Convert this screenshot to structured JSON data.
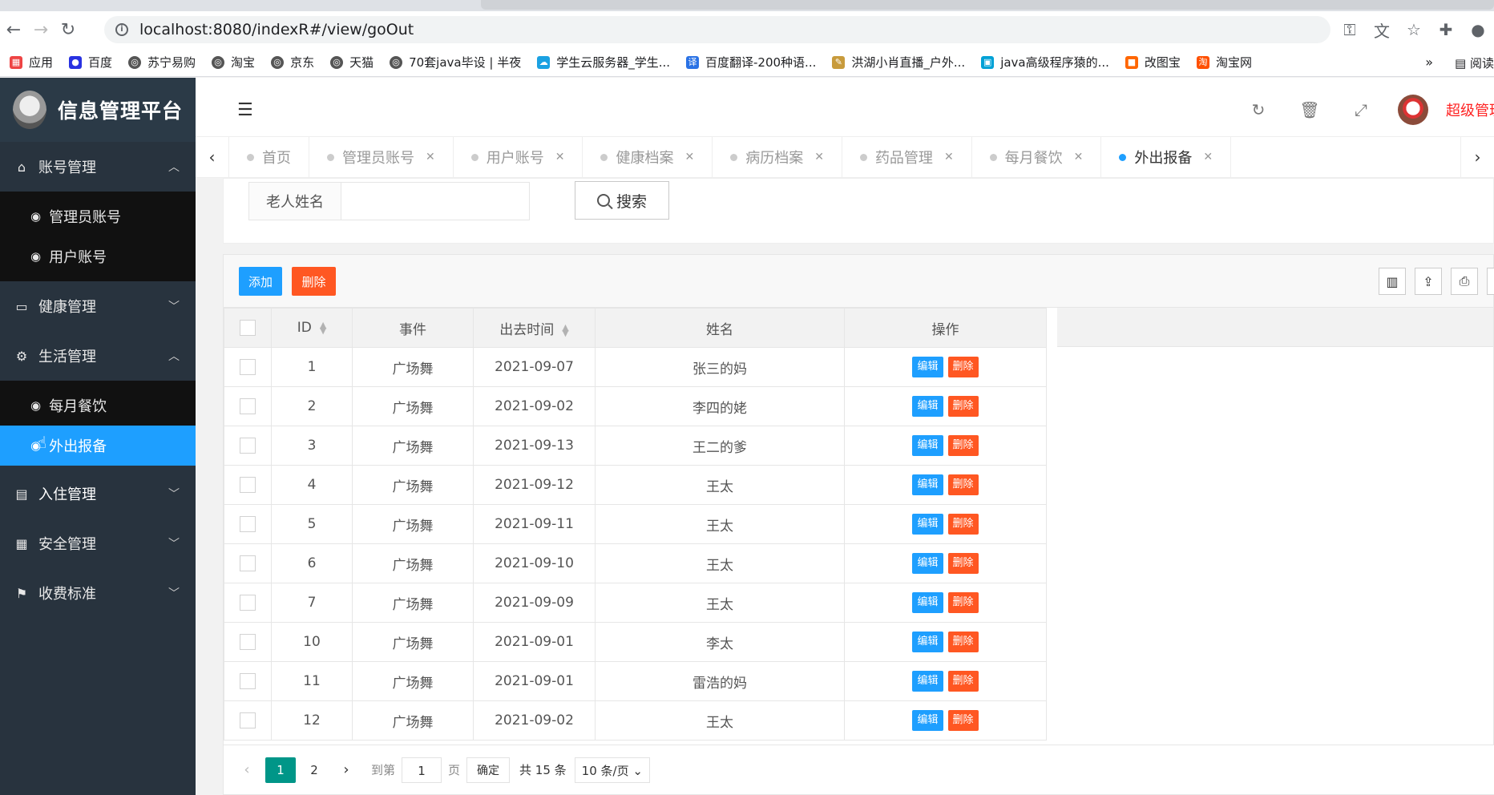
{
  "browser": {
    "url": "localhost:8080/indexR#/view/goOut",
    "bookmarks": [
      "应用",
      "百度",
      "苏宁易购",
      "淘宝",
      "京东",
      "天猫",
      "70套java毕设 | 半夜",
      "学生云服务器_学生...",
      "百度翻译-200种语...",
      "洪湖小肖直播_户外...",
      "java高级程序猿的...",
      "改图宝",
      "淘宝网"
    ],
    "more": "»",
    "reading_list": "阅读"
  },
  "sidebar": {
    "title": "信息管理平台",
    "groups": [
      {
        "label": "账号管理",
        "items": [
          "管理员账号",
          "用户账号"
        ]
      },
      {
        "label": "健康管理"
      },
      {
        "label": "生活管理",
        "items": [
          "每月餐饮",
          "外出报备"
        ]
      },
      {
        "label": "入住管理"
      },
      {
        "label": "安全管理"
      },
      {
        "label": "收费标准"
      }
    ]
  },
  "header": {
    "username": "超级管理员"
  },
  "tabs": [
    "首页",
    "管理员账号",
    "用户账号",
    "健康档案",
    "病历档案",
    "药品管理",
    "每月餐饮",
    "外出报备"
  ],
  "search": {
    "label": "老人姓名",
    "input_value": "",
    "button": "搜索"
  },
  "toolbar": {
    "add": "添加",
    "delete": "删除"
  },
  "table": {
    "headers": [
      "ID",
      "事件",
      "出去时间",
      "姓名",
      "操作"
    ],
    "edit_label": "编辑",
    "delete_label": "删除",
    "rows": [
      {
        "id": "1",
        "event": "广场舞",
        "time": "2021-09-07",
        "name": "张三的妈"
      },
      {
        "id": "2",
        "event": "广场舞",
        "time": "2021-09-02",
        "name": "李四的姥"
      },
      {
        "id": "3",
        "event": "广场舞",
        "time": "2021-09-13",
        "name": "王二的爹"
      },
      {
        "id": "4",
        "event": "广场舞",
        "time": "2021-09-12",
        "name": "王太"
      },
      {
        "id": "5",
        "event": "广场舞",
        "time": "2021-09-11",
        "name": "王太"
      },
      {
        "id": "6",
        "event": "广场舞",
        "time": "2021-09-10",
        "name": "王太"
      },
      {
        "id": "7",
        "event": "广场舞",
        "time": "2021-09-09",
        "name": "王太"
      },
      {
        "id": "10",
        "event": "广场舞",
        "time": "2021-09-01",
        "name": "李太"
      },
      {
        "id": "11",
        "event": "广场舞",
        "time": "2021-09-01",
        "name": "雷浩的妈"
      },
      {
        "id": "12",
        "event": "广场舞",
        "time": "2021-09-02",
        "name": "王太"
      }
    ]
  },
  "pager": {
    "pages": [
      "1",
      "2"
    ],
    "goto_label": "到第",
    "goto_value": "1",
    "page_label": "页",
    "confirm": "确定",
    "total": "共 15 条",
    "page_size": "10 条/页"
  }
}
